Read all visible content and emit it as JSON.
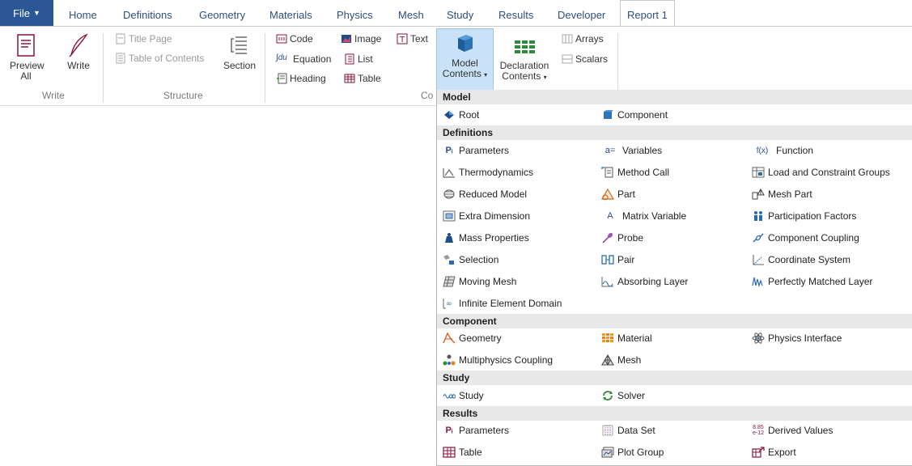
{
  "tabs": {
    "file": "File",
    "home": "Home",
    "definitions": "Definitions",
    "geometry": "Geometry",
    "materials": "Materials",
    "physics": "Physics",
    "mesh": "Mesh",
    "study": "Study",
    "results": "Results",
    "developer": "Developer",
    "report": "Report 1"
  },
  "ribbon": {
    "write_group": {
      "label": "Write",
      "preview": "Preview All",
      "write": "Write"
    },
    "structure_group": {
      "label": "Structure",
      "title_page": "Title Page",
      "toc": "Table of Contents",
      "section": "Section"
    },
    "content_group": {
      "label": "Co",
      "code": "Code",
      "image": "Image",
      "text": "Text",
      "equation": "Equation",
      "list": "List",
      "heading": "Heading",
      "table": "Table",
      "model_contents_1": "Model",
      "model_contents_2": "Contents",
      "declaration_contents_1": "Declaration",
      "declaration_contents_2": "Contents",
      "arrays": "Arrays",
      "scalars": "Scalars"
    }
  },
  "menu": {
    "model": {
      "header": "Model",
      "items": [
        {
          "label": "Root",
          "icon": "root-icon"
        },
        {
          "label": "Component",
          "icon": "component-icon"
        }
      ]
    },
    "definitions": {
      "header": "Definitions",
      "items": [
        {
          "label": "Parameters",
          "icon": "parameters-icon"
        },
        {
          "label": "Variables",
          "icon": "variables-icon"
        },
        {
          "label": "Function",
          "icon": "function-icon"
        },
        {
          "label": "Thermodynamics",
          "icon": "thermodynamics-icon"
        },
        {
          "label": "Method Call",
          "icon": "method-call-icon"
        },
        {
          "label": "Load and Constraint Groups",
          "icon": "load-constraint-icon"
        },
        {
          "label": "Reduced Model",
          "icon": "reduced-model-icon"
        },
        {
          "label": "Part",
          "icon": "part-icon"
        },
        {
          "label": "Mesh Part",
          "icon": "mesh-part-icon"
        },
        {
          "label": "Extra Dimension",
          "icon": "extra-dimension-icon"
        },
        {
          "label": "Matrix Variable",
          "icon": "matrix-variable-icon"
        },
        {
          "label": "Participation Factors",
          "icon": "participation-factors-icon"
        },
        {
          "label": "Mass Properties",
          "icon": "mass-properties-icon"
        },
        {
          "label": "Probe",
          "icon": "probe-icon"
        },
        {
          "label": "Component Coupling",
          "icon": "component-coupling-icon"
        },
        {
          "label": "Selection",
          "icon": "selection-icon"
        },
        {
          "label": "Pair",
          "icon": "pair-icon"
        },
        {
          "label": "Coordinate System",
          "icon": "coordinate-system-icon"
        },
        {
          "label": "Moving Mesh",
          "icon": "moving-mesh-icon"
        },
        {
          "label": "Absorbing Layer",
          "icon": "absorbing-layer-icon"
        },
        {
          "label": "Perfectly Matched Layer",
          "icon": "pml-icon"
        },
        {
          "label": "Infinite Element Domain",
          "icon": "infinite-element-icon"
        }
      ]
    },
    "component": {
      "header": "Component",
      "items": [
        {
          "label": "Geometry",
          "icon": "geometry-icon"
        },
        {
          "label": "Material",
          "icon": "material-icon"
        },
        {
          "label": "Physics Interface",
          "icon": "physics-interface-icon"
        },
        {
          "label": "Multiphysics Coupling",
          "icon": "multiphysics-icon"
        },
        {
          "label": "Mesh",
          "icon": "mesh-icon"
        }
      ]
    },
    "study": {
      "header": "Study",
      "items": [
        {
          "label": "Study",
          "icon": "study-icon"
        },
        {
          "label": "Solver",
          "icon": "solver-icon"
        }
      ]
    },
    "results": {
      "header": "Results",
      "items": [
        {
          "label": "Parameters",
          "icon": "parameters-icon"
        },
        {
          "label": "Data Set",
          "icon": "data-set-icon"
        },
        {
          "label": "Derived Values",
          "icon": "derived-values-icon"
        },
        {
          "label": "Table",
          "icon": "table-icon"
        },
        {
          "label": "Plot Group",
          "icon": "plot-group-icon"
        },
        {
          "label": "Export",
          "icon": "export-icon"
        }
      ]
    }
  },
  "colors": {
    "file_tab": "#2b5797",
    "accent_blue": "#2b6cb0",
    "selection": "#c9e2f7",
    "header_bg": "#e8e8e8"
  }
}
